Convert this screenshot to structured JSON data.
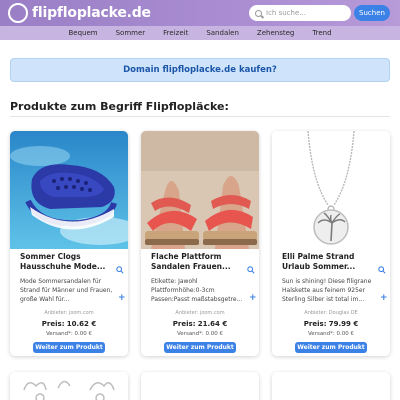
{
  "header": {
    "site_name": "flipfloplacke.de",
    "search_placeholder": "Ich suche...",
    "search_button": "Suchen"
  },
  "nav": {
    "items": [
      "Bequem",
      "Sommer",
      "Freizeit",
      "Sandalen",
      "Zehensteg",
      "Trend"
    ]
  },
  "domain_banner": "Domain flipfloplacke.de kaufen?",
  "section_title": "Produkte zum Begriff Flipflopläcke:",
  "products": [
    {
      "title": "Sommer Clogs Hausschuhe Mode...",
      "description": "Mode Sommersandalen für Strand für Männer und Frauen, große Wahl für...",
      "source": "Anbieter: joom.com",
      "price_label": "Preis:",
      "price": "10.62 €",
      "shipping": "Versand*: 0.00 €",
      "button": "Weiter zum Produkt"
    },
    {
      "title": "Flache Plattform Sandalen Frauen...",
      "description": "Etikette: Jawohl Plattformhöhe:0-3cm Passen:Passt maßstabsgetre...",
      "source": "Anbieter: joom.com",
      "price_label": "Preis:",
      "price": "21.64 €",
      "shipping": "Versand*: 0.00 €",
      "button": "Weiter zum Produkt"
    },
    {
      "title": "Elli Palme Strand Urlaub Sommer...",
      "description": "Sun is shining! Diese filigrane Halskette aus feinem 925er Sterling Silber ist total im...",
      "source": "Anbieter: Douglas DE",
      "price_label": "Preis:",
      "price": "79.99 €",
      "shipping": "Versand*: 0.00 €",
      "button": "Weiter zum Produkt"
    }
  ],
  "colors": {
    "header_bg": "#9a7fc6",
    "nav_bg": "#c8b4e0",
    "accent_blue": "#3c82e6",
    "banner_bg": "#cfe4fb"
  }
}
